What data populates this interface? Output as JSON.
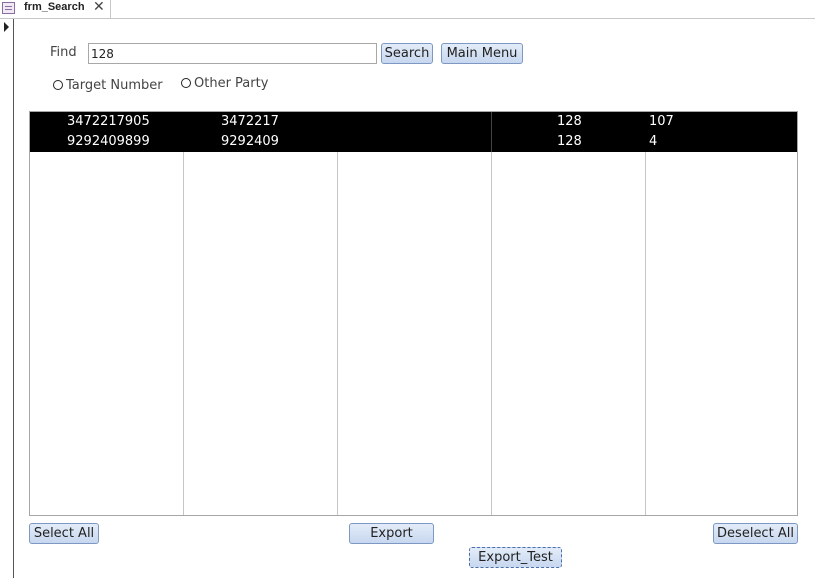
{
  "tab": {
    "title": "frm_Search",
    "close": "✕"
  },
  "find": {
    "label": "Find",
    "value": "128"
  },
  "buttons": {
    "search": "Search",
    "main_menu": "Main Menu",
    "select_all": "Select All",
    "export": "Export",
    "deselect_all": "Deselect All",
    "export_test": "Export_Test"
  },
  "radios": {
    "target_number": "Target Number",
    "other_party": "Other Party"
  },
  "results": [
    [
      "3472217905",
      "3472217",
      "",
      "128",
      "107"
    ],
    [
      "9292409899",
      "9292409",
      "",
      "128",
      "4"
    ]
  ],
  "colors": {
    "selection_bg": "#000000",
    "selection_fg": "#ffffff",
    "button_border": "#7d98c2"
  }
}
